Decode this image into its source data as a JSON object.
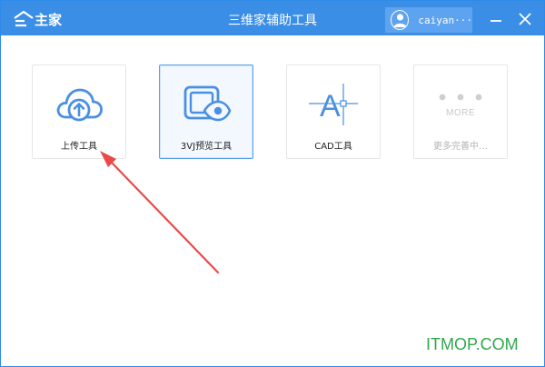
{
  "titlebar": {
    "logo_text": "主家",
    "title": "三维家辅助工具",
    "username": "caiyan···",
    "minimize_label": "minimize",
    "close_label": "close"
  },
  "tools": [
    {
      "label": "上传工具",
      "icon": "cloud-upload-icon",
      "state": "normal"
    },
    {
      "label": "3VJ预览工具",
      "icon": "preview-eye-icon",
      "state": "selected"
    },
    {
      "label": "CAD工具",
      "icon": "cad-letter-icon",
      "state": "normal"
    },
    {
      "label": "更多完善中…",
      "icon": "more-dots-icon",
      "more_word": "MORE",
      "state": "disabled"
    }
  ],
  "annotation": {
    "arrow_color": "#e84a4a"
  },
  "watermark": "ITMOP.COM",
  "colors": {
    "accent": "#3a8ee6",
    "icon_blue": "#4a90e2",
    "watermark_green": "#2fa84c"
  }
}
